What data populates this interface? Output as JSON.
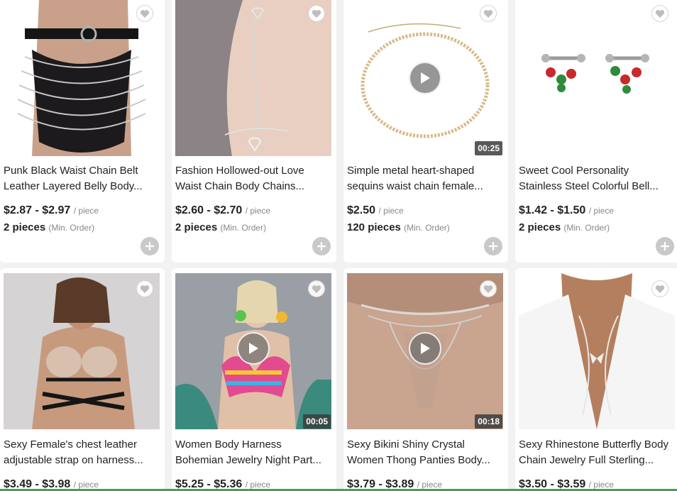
{
  "products": [
    {
      "title_line1": "Punk Black Waist Chain Belt",
      "title_line2": "Leather Layered Belly Body...",
      "price": "$2.87 - $2.97",
      "unit": "/ piece",
      "moq": "2 pieces",
      "moq_label": "(Min. Order)",
      "icon": "heart-icon",
      "has_video": false,
      "duration": ""
    },
    {
      "title_line1": "Fashion Hollowed-out Love",
      "title_line2": "Waist Chain Body Chains...",
      "price": "$2.60 - $2.70",
      "unit": "/ piece",
      "moq": "2 pieces",
      "moq_label": "(Min. Order)",
      "icon": "heart-icon",
      "has_video": false,
      "duration": ""
    },
    {
      "title_line1": "Simple metal heart-shaped",
      "title_line2": "sequins waist chain female...",
      "price": "$2.50",
      "unit": "/ piece",
      "moq": "120 pieces",
      "moq_label": "(Min. Order)",
      "icon": "heart-icon",
      "has_video": true,
      "duration": "00:25"
    },
    {
      "title_line1": "Sweet Cool Personality",
      "title_line2": "Stainless Steel Colorful Bell...",
      "price": "$1.42 - $1.50",
      "unit": "/ piece",
      "moq": "2 pieces",
      "moq_label": "(Min. Order)",
      "icon": "heart-icon",
      "has_video": false,
      "duration": ""
    },
    {
      "title_line1": "Sexy Female's chest leather",
      "title_line2": "adjustable strap on harness...",
      "price": "$3.49 - $3.98",
      "unit": "/ piece",
      "moq": "",
      "moq_label": "",
      "icon": "heart-icon",
      "has_video": false,
      "duration": ""
    },
    {
      "title_line1": "Women Body Harness",
      "title_line2": "Bohemian Jewelry Night Part...",
      "price": "$5.25 - $5.36",
      "unit": "/ piece",
      "moq": "",
      "moq_label": "",
      "icon": "heart-icon",
      "has_video": true,
      "duration": "00:05"
    },
    {
      "title_line1": "Sexy Bikini Shiny Crystal",
      "title_line2": "Women Thong Panties Body...",
      "price": "$3.79 - $3.89",
      "unit": "/ piece",
      "moq": "",
      "moq_label": "",
      "icon": "heart-icon",
      "has_video": true,
      "duration": "00:18"
    },
    {
      "title_line1": "Sexy Rhinestone Butterfly Body",
      "title_line2": "Chain Jewelry Full Sterling...",
      "price": "$3.50 - $3.59",
      "unit": "/ piece",
      "moq": "",
      "moq_label": "",
      "icon": "heart-icon",
      "has_video": false,
      "duration": ""
    }
  ],
  "colors": {
    "page_bg": "#f2f2f2",
    "card_bg": "#ffffff",
    "accent_bar": "#37a84f",
    "add_button": "#c9c9c9"
  }
}
